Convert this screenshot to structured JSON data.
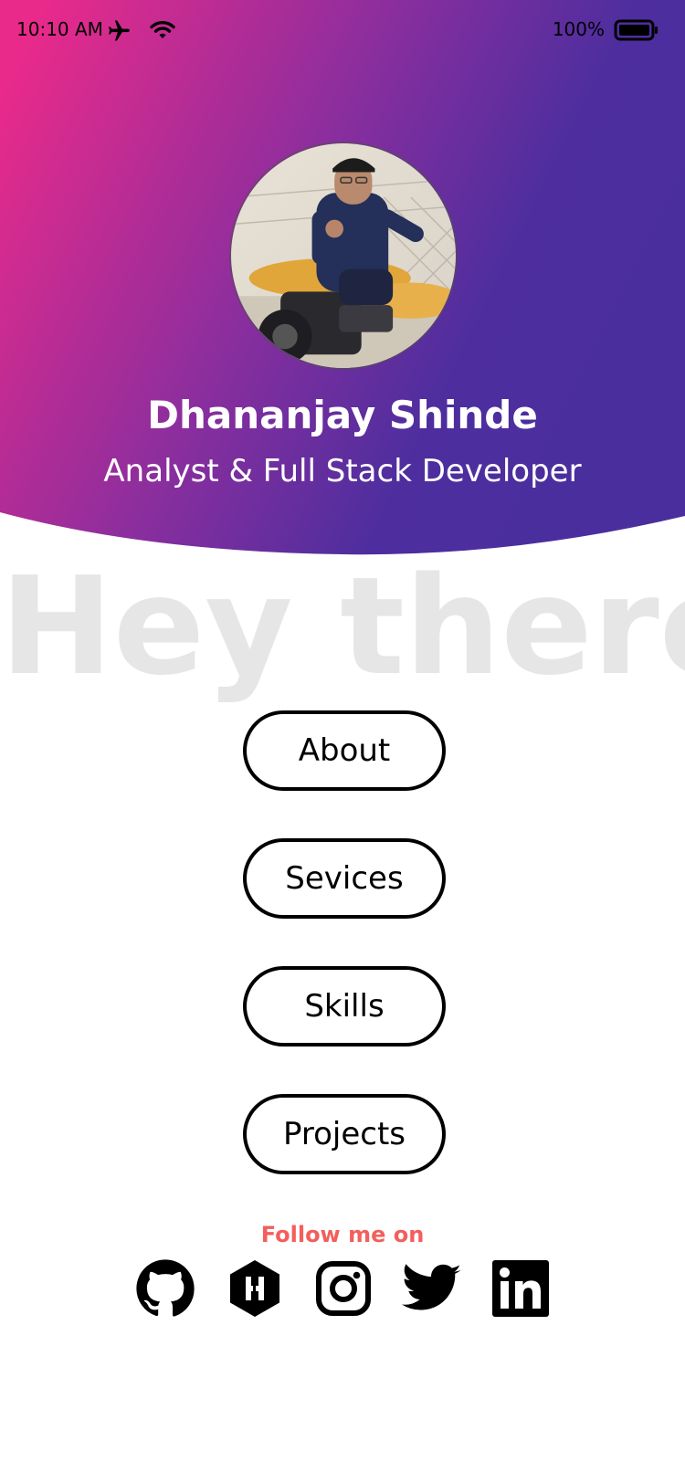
{
  "status_bar": {
    "time": "10:10 AM",
    "battery_percent": "100%",
    "icons": [
      "airplane-icon",
      "wifi-icon",
      "battery-icon"
    ]
  },
  "theme": {
    "gradient_start": "#ea2a8a",
    "gradient_mid": "#8a2e9e",
    "gradient_end": "#4a2e9e",
    "button_border": "#000000",
    "follow_color": "#f25f5c",
    "watermark_color": "#e6e6e6"
  },
  "profile": {
    "name": "Dhananjay Shinde",
    "role": "Analyst & Full Stack Developer",
    "avatar_alt": "profile-photo"
  },
  "watermark": "Hey there",
  "nav": {
    "about": "About",
    "services": "Sevices",
    "skills": "Skills",
    "projects": "Projects"
  },
  "follow_label": "Follow me on",
  "social_links": [
    "github-icon",
    "hashnode-icon",
    "instagram-icon",
    "twitter-icon",
    "linkedin-icon"
  ]
}
